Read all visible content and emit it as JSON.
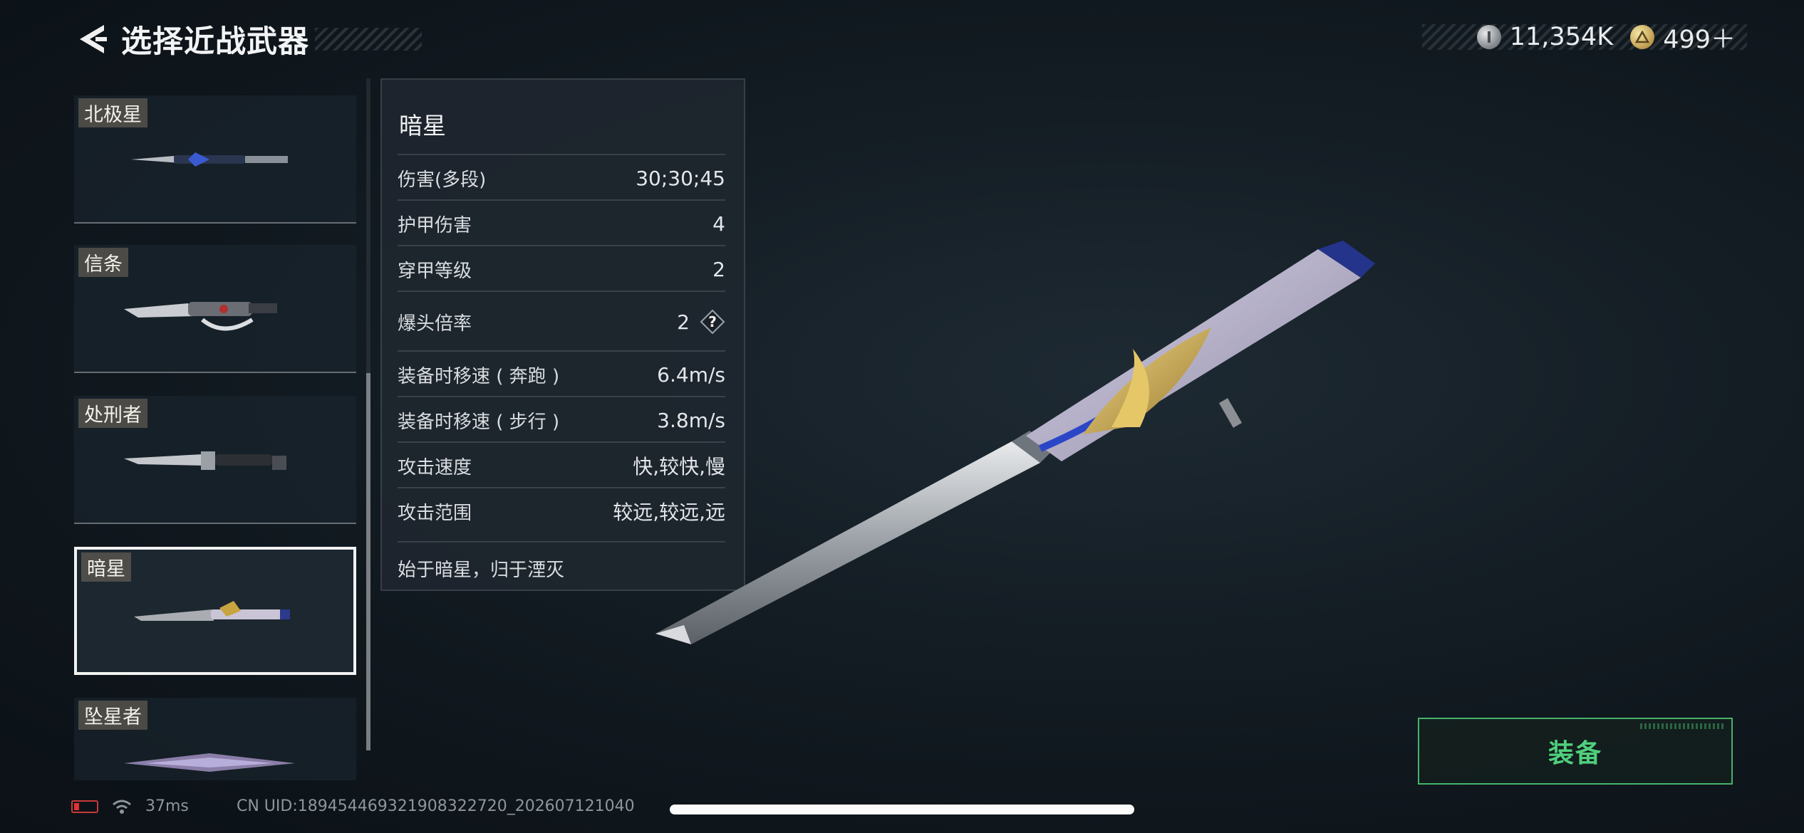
{
  "header": {
    "title": "选择近战武器"
  },
  "currency": {
    "silver_amount": "11,354K",
    "gold_amount": "499＋"
  },
  "weapons": [
    {
      "name": "北极星"
    },
    {
      "name": "信条"
    },
    {
      "name": "处刑者"
    },
    {
      "name": "暗星"
    },
    {
      "name": "坠星者"
    }
  ],
  "selected_weapon": "暗星",
  "stats": {
    "name": "暗星",
    "rows": [
      {
        "label": "伤害(多段)",
        "value": "30;30;45"
      },
      {
        "label": "护甲伤害",
        "value": "4"
      },
      {
        "label": "穿甲等级",
        "value": "2"
      },
      {
        "label": "爆头倍率",
        "value": "2"
      },
      {
        "label": "装备时移速 ( 奔跑 )",
        "value": "6.4m/s"
      },
      {
        "label": "装备时移速 ( 步行 )",
        "value": "3.8m/s"
      },
      {
        "label": "攻击速度",
        "value": "快,较快,慢"
      },
      {
        "label": "攻击范围",
        "value": "较远,较远,远"
      }
    ],
    "description": "始于暗星，归于湮灭"
  },
  "equip_button": {
    "label": "装备"
  },
  "status_bar": {
    "ping": "37ms",
    "uid": "CN UID:18945446932190832272​0_202607121040"
  },
  "colors": {
    "accent_green": "#4fd07c",
    "selected_border": "#f2f2f2"
  }
}
